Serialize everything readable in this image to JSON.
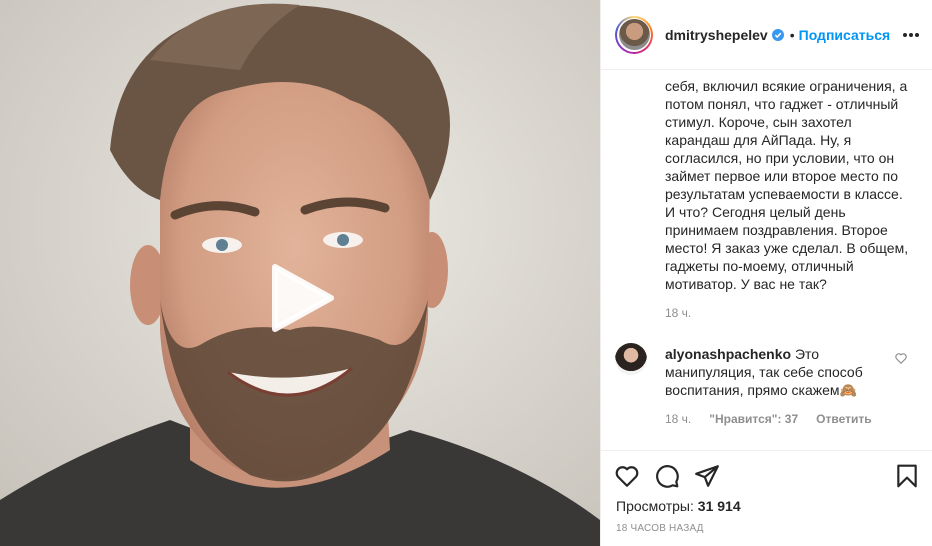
{
  "header": {
    "username": "dmitryshepelev",
    "separator": "•",
    "follow_label": "Подписаться"
  },
  "caption": {
    "lines": [
      "себя, включил всякие ограничения, а",
      "потом понял, что гаджет - отличный",
      "стимул. Короче, сын захотел",
      "карандаш для АйПада. Ну, я",
      "согласился, но при условии, что он",
      "займет первое или второе место по",
      "результатам успеваемости в классе.",
      "И что? Сегодня целый день",
      "принимаем поздравления. Второе",
      "место! Я заказ уже сделал. В общем,",
      "гаджеты по-моему, отличный",
      "мотиватор. У вас не так?"
    ],
    "time": "18 ч."
  },
  "comment": {
    "username": "alyonashpachenko",
    "text": "Это манипуляция, так себе способ воспитания, прямо скажем🙈",
    "time": "18 ч.",
    "likes": "\"Нравится\": 37",
    "reply_label": "Ответить"
  },
  "stats": {
    "views_label": "Просмотры:",
    "views_count": "31 914",
    "posted_ago": "18 часов назад"
  },
  "icons": {
    "verified": "verified-badge-icon",
    "more": "more-options-icon",
    "like": "heart-icon",
    "comment": "comment-bubble-icon",
    "share": "paper-plane-icon",
    "save": "bookmark-icon",
    "play": "play-icon"
  },
  "colors": {
    "link_blue": "#0095f6",
    "muted": "#8e8e8e",
    "text": "#262626"
  }
}
